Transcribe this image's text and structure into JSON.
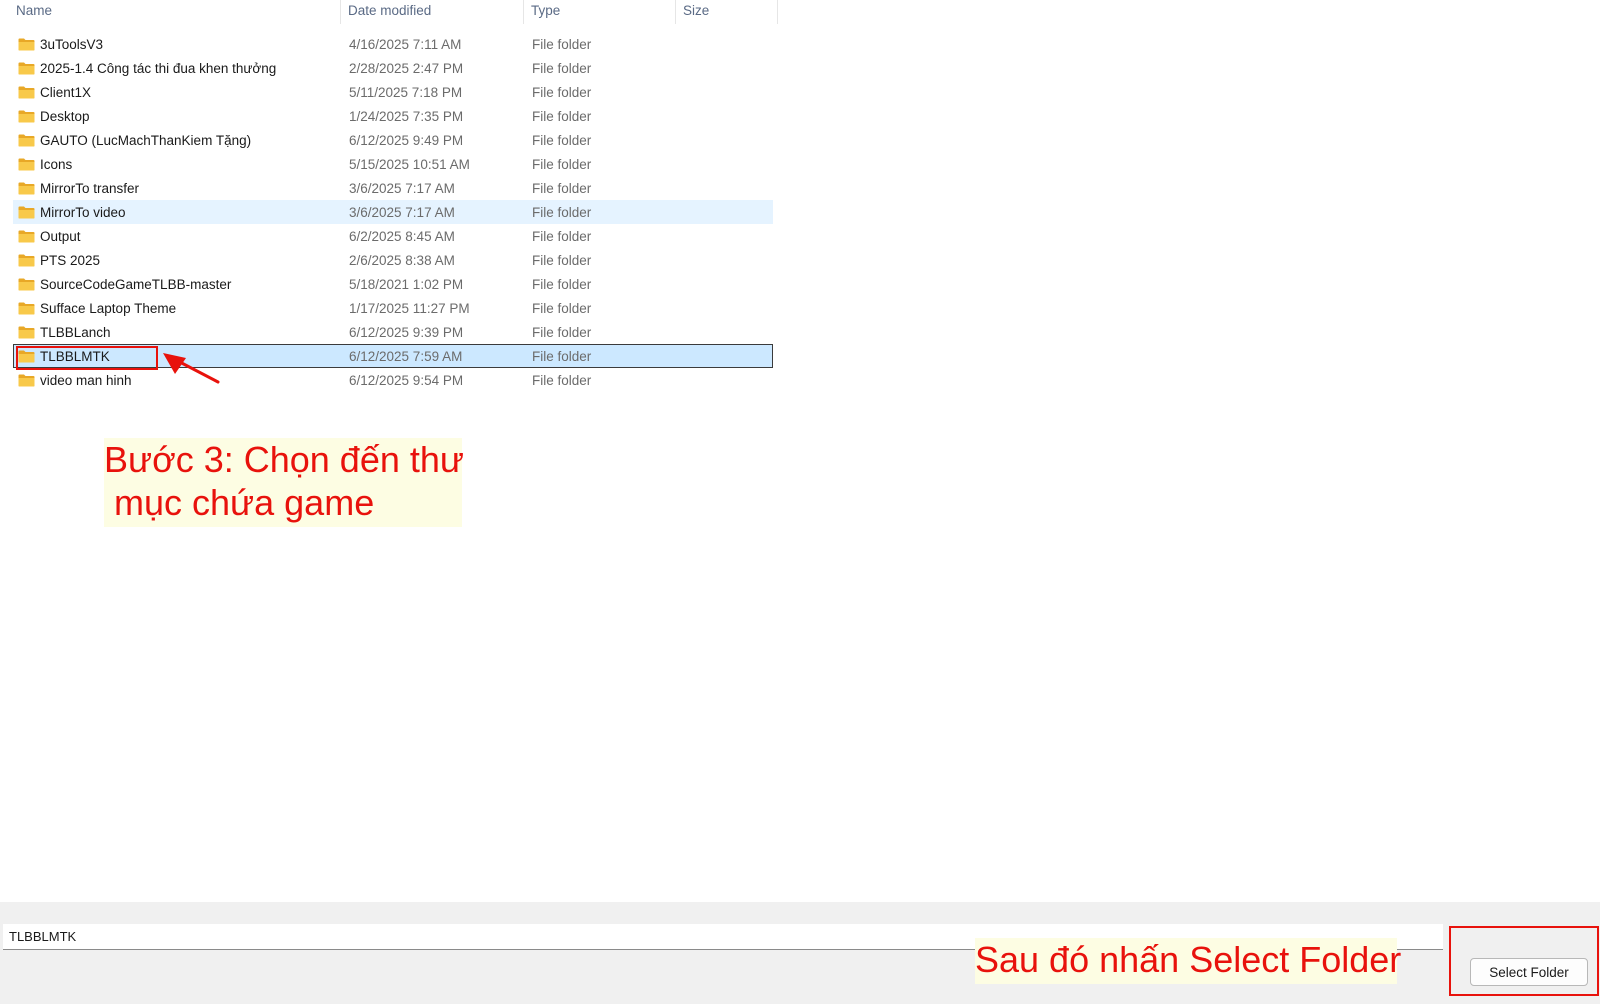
{
  "columns": {
    "name": "Name",
    "date": "Date modified",
    "type": "Type",
    "size": "Size"
  },
  "rows": [
    {
      "name": "3uToolsV3",
      "date": "4/16/2025 7:11 AM",
      "type": "File folder"
    },
    {
      "name": "2025-1.4 Công tác thi đua khen thưởng",
      "date": "2/28/2025 2:47 PM",
      "type": "File folder"
    },
    {
      "name": "Client1X",
      "date": "5/11/2025 7:18 PM",
      "type": "File folder"
    },
    {
      "name": "Desktop",
      "date": "1/24/2025 7:35 PM",
      "type": "File folder"
    },
    {
      "name": "GAUTO (LucMachThanKiem Tặng)",
      "date": "6/12/2025 9:49 PM",
      "type": "File folder"
    },
    {
      "name": "Icons",
      "date": "5/15/2025 10:51 AM",
      "type": "File folder"
    },
    {
      "name": "MirrorTo transfer",
      "date": "3/6/2025 7:17 AM",
      "type": "File folder"
    },
    {
      "name": "MirrorTo video",
      "date": "3/6/2025 7:17 AM",
      "type": "File folder",
      "state": "hover"
    },
    {
      "name": "Output",
      "date": "6/2/2025 8:45 AM",
      "type": "File folder"
    },
    {
      "name": "PTS 2025",
      "date": "2/6/2025 8:38 AM",
      "type": "File folder"
    },
    {
      "name": "SourceCodeGameTLBB-master",
      "date": "5/18/2021 1:02 PM",
      "type": "File folder"
    },
    {
      "name": "Sufface Laptop Theme",
      "date": "1/17/2025 11:27 PM",
      "type": "File folder"
    },
    {
      "name": "TLBBLanch",
      "date": "6/12/2025 9:39 PM",
      "type": "File folder"
    },
    {
      "name": "TLBBLMTK",
      "date": "6/12/2025 7:59 AM",
      "type": "File folder",
      "state": "selected"
    },
    {
      "name": "video man hinh",
      "date": "6/12/2025 9:54 PM",
      "type": "File folder"
    }
  ],
  "annotations": {
    "step3": "Bước 3: Chọn đến thư\n mục chứa game",
    "then": "Sau đó nhấn Select Folder"
  },
  "bottom": {
    "folder_name_value": "TLBBLMTK",
    "select_label": "Select Folder"
  },
  "colors": {
    "annotation_red": "#e8120c",
    "annotation_bg": "#fdfde3",
    "selected_row": "#cce8ff",
    "hover_row": "#e5f3ff",
    "folder_yellow": "#f8c94a"
  },
  "icons": {
    "row_icon": "folder-icon",
    "pointer": "red-arrow"
  }
}
